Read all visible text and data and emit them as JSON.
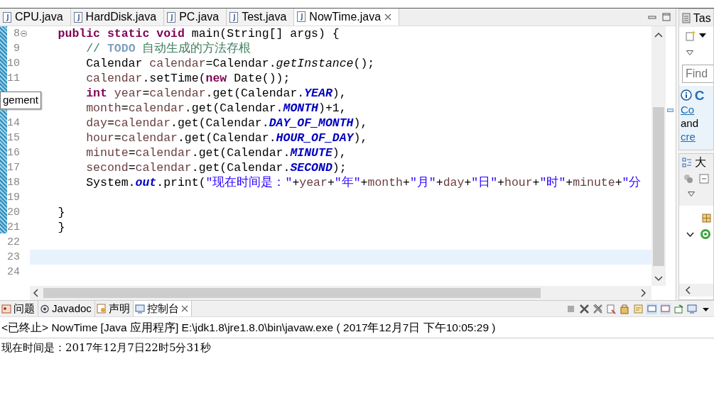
{
  "editor_tabs": [
    {
      "label": "CPU.java",
      "selected": false,
      "closable": false
    },
    {
      "label": "HardDisk.java",
      "selected": false,
      "closable": false
    },
    {
      "label": "PC.java",
      "selected": false,
      "closable": false
    },
    {
      "label": "Test.java",
      "selected": false,
      "closable": false
    },
    {
      "label": "NowTime.java",
      "selected": true,
      "closable": true
    }
  ],
  "editor": {
    "lines": [
      {
        "number": "8",
        "fold": true,
        "current": false,
        "tokens": [
          {
            "kind": "keyword",
            "text": "    public static void"
          },
          {
            "kind": "plain",
            "text": " main(String[] args) {"
          }
        ]
      },
      {
        "number": "9",
        "fold": false,
        "current": false,
        "tokens": [
          {
            "kind": "comment",
            "text": "        // "
          },
          {
            "kind": "todo",
            "text": "TODO"
          },
          {
            "kind": "comment",
            "text": " 自动生成的方法存根"
          }
        ]
      },
      {
        "number": "10",
        "fold": false,
        "current": false,
        "tokens": [
          {
            "kind": "plain",
            "text": "        Calendar "
          },
          {
            "kind": "local",
            "text": "calendar"
          },
          {
            "kind": "plain",
            "text": "=Calendar."
          },
          {
            "kind": "static_method",
            "text": "getInstance"
          },
          {
            "kind": "plain",
            "text": "();"
          }
        ]
      },
      {
        "number": "11",
        "fold": false,
        "current": false,
        "tokens": [
          {
            "kind": "local",
            "text": "        calendar"
          },
          {
            "kind": "plain",
            "text": ".setTime("
          },
          {
            "kind": "keyword",
            "text": "new"
          },
          {
            "kind": "plain",
            "text": " Date());"
          }
        ]
      },
      {
        "fold": false,
        "current": false,
        "tokens": [
          {
            "kind": "keyword",
            "text": "        int"
          },
          {
            "kind": "local",
            "text": " year"
          },
          {
            "kind": "plain",
            "text": "="
          },
          {
            "kind": "local",
            "text": "calendar"
          },
          {
            "kind": "plain",
            "text": ".get(Calendar."
          },
          {
            "kind": "static_field",
            "text": "YEAR"
          },
          {
            "kind": "plain",
            "text": "),"
          }
        ]
      },
      {
        "fold": false,
        "current": false,
        "tokens": [
          {
            "kind": "local",
            "text": "        month"
          },
          {
            "kind": "plain",
            "text": "="
          },
          {
            "kind": "local",
            "text": "calendar"
          },
          {
            "kind": "plain",
            "text": ".get(Calendar."
          },
          {
            "kind": "static_field",
            "text": "MONTH"
          },
          {
            "kind": "plain",
            "text": ")+1,"
          }
        ]
      },
      {
        "number": "14",
        "fold": false,
        "current": false,
        "tokens": [
          {
            "kind": "local",
            "text": "        day"
          },
          {
            "kind": "plain",
            "text": "="
          },
          {
            "kind": "local",
            "text": "calendar"
          },
          {
            "kind": "plain",
            "text": ".get(Calendar."
          },
          {
            "kind": "static_field",
            "text": "DAY_OF_MONTH"
          },
          {
            "kind": "plain",
            "text": "),"
          }
        ]
      },
      {
        "number": "15",
        "fold": false,
        "current": false,
        "tokens": [
          {
            "kind": "local",
            "text": "        hour"
          },
          {
            "kind": "plain",
            "text": "="
          },
          {
            "kind": "local",
            "text": "calendar"
          },
          {
            "kind": "plain",
            "text": ".get(Calendar."
          },
          {
            "kind": "static_field",
            "text": "HOUR_OF_DAY"
          },
          {
            "kind": "plain",
            "text": "),"
          }
        ]
      },
      {
        "number": "16",
        "fold": false,
        "current": false,
        "tokens": [
          {
            "kind": "local",
            "text": "        minute"
          },
          {
            "kind": "plain",
            "text": "="
          },
          {
            "kind": "local",
            "text": "calendar"
          },
          {
            "kind": "plain",
            "text": ".get(Calendar."
          },
          {
            "kind": "static_field",
            "text": "MINUTE"
          },
          {
            "kind": "plain",
            "text": "),"
          }
        ]
      },
      {
        "number": "17",
        "fold": false,
        "current": false,
        "tokens": [
          {
            "kind": "local",
            "text": "        second"
          },
          {
            "kind": "plain",
            "text": "="
          },
          {
            "kind": "local",
            "text": "calendar"
          },
          {
            "kind": "plain",
            "text": ".get(Calendar."
          },
          {
            "kind": "static_field",
            "text": "SECOND"
          },
          {
            "kind": "plain",
            "text": ");"
          }
        ]
      },
      {
        "number": "18",
        "fold": false,
        "current": false,
        "tokens": [
          {
            "kind": "plain",
            "text": "        System."
          },
          {
            "kind": "static_field",
            "text": "out"
          },
          {
            "kind": "plain",
            "text": ".print("
          },
          {
            "kind": "string",
            "text": "\"现在时间是：\""
          },
          {
            "kind": "plain",
            "text": "+"
          },
          {
            "kind": "local",
            "text": "year"
          },
          {
            "kind": "plain",
            "text": "+"
          },
          {
            "kind": "string",
            "text": "\"年\""
          },
          {
            "kind": "plain",
            "text": "+"
          },
          {
            "kind": "local",
            "text": "month"
          },
          {
            "kind": "plain",
            "text": "+"
          },
          {
            "kind": "string",
            "text": "\"月\""
          },
          {
            "kind": "plain",
            "text": "+"
          },
          {
            "kind": "local",
            "text": "day"
          },
          {
            "kind": "plain",
            "text": "+"
          },
          {
            "kind": "string",
            "text": "\"日\""
          },
          {
            "kind": "plain",
            "text": "+"
          },
          {
            "kind": "local",
            "text": "hour"
          },
          {
            "kind": "plain",
            "text": "+"
          },
          {
            "kind": "string",
            "text": "\"时\""
          },
          {
            "kind": "plain",
            "text": "+"
          },
          {
            "kind": "local",
            "text": "minute"
          },
          {
            "kind": "plain",
            "text": "+"
          },
          {
            "kind": "string",
            "text": "\"分"
          }
        ]
      },
      {
        "number": "19",
        "fold": false,
        "current": false
      },
      {
        "number": "20",
        "fold": false,
        "current": false,
        "tokens": [
          {
            "kind": "plain",
            "text": "    }"
          }
        ]
      },
      {
        "number": "21",
        "fold": false,
        "current": false,
        "tokens": [
          {
            "kind": "plain",
            "text": "    }"
          }
        ]
      },
      {
        "number": "22",
        "fold": false,
        "current": false
      },
      {
        "number": "23",
        "fold": false,
        "current": true
      },
      {
        "number": "24",
        "fold": false,
        "current": false
      }
    ],
    "tooltip": "gement"
  },
  "task_panel": {
    "tab": "Tas",
    "find_placeholder": "Find",
    "heading": "C",
    "link_1": "Co",
    "text": "and",
    "link_2": "cre"
  },
  "outline_panel": {
    "tab": "大"
  },
  "console_tabs": [
    {
      "label": "问题",
      "selected": false,
      "closable": false
    },
    {
      "label": "Javadoc",
      "selected": false,
      "closable": false
    },
    {
      "label": "声明",
      "selected": false,
      "closable": false
    },
    {
      "label": "控制台",
      "selected": true,
      "closable": true
    }
  ],
  "console": {
    "header": "<已终止> NowTime [Java 应用程序] E:\\jdk1.8\\jre1.8.0\\bin\\javaw.exe ( 2017年12月7日 下午10:05:29 )",
    "output": "现在时间是：2017年12月7日22时5分31秒"
  }
}
